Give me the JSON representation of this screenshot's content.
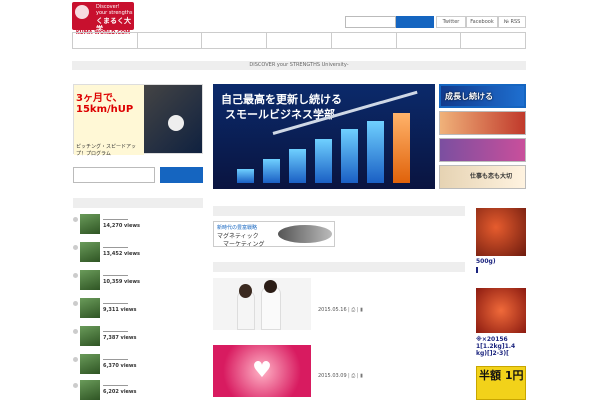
{
  "header": {
    "logo_line1": "Discover!",
    "logo_line2": "your strengths",
    "logo_line3": "くまるく大学",
    "logo_url_text": "KUMA-WORLD.COM",
    "search_placeholder": "",
    "social": [
      "Twitter",
      "Facebook",
      "RSS"
    ]
  },
  "nav": {
    "items": [
      "",
      "",
      "",
      "",
      "",
      "",
      ""
    ]
  },
  "tagline": "DISCOVER your STRENGTHS University-",
  "left_banner": {
    "title": "3ヶ月で、15km/hUP",
    "subtitle": "ピッチング・スピードアップ！プログラム"
  },
  "sidebar_ranking": {
    "items": [
      {
        "views": "14,270 views"
      },
      {
        "views": "13,452 views"
      },
      {
        "views": "10,359 views"
      },
      {
        "views": "9,311 views"
      },
      {
        "views": "7,387 views"
      },
      {
        "views": "6,370 views"
      },
      {
        "views": "6,202 views"
      }
    ]
  },
  "main_banner": {
    "line1": "自己最高を更新し続ける",
    "line2": "スモールビジネス学部"
  },
  "thumbs": [
    "成長し続ける",
    "",
    "",
    "仕事も恋も大切"
  ],
  "mag_banner": {
    "line1": "新時代の豊富戦略",
    "line2": "マグネティック",
    "line3": "マーケティング"
  },
  "posts": [
    {
      "date": "2015.05.16"
    },
    {
      "date": "2015.03.09"
    }
  ],
  "ads": [
    {
      "text": "500g)"
    },
    {
      "text": "※×20156 1[1.2kg]1.4 kg)[]2-3)["
    },
    {
      "text": "半額 1円"
    }
  ]
}
